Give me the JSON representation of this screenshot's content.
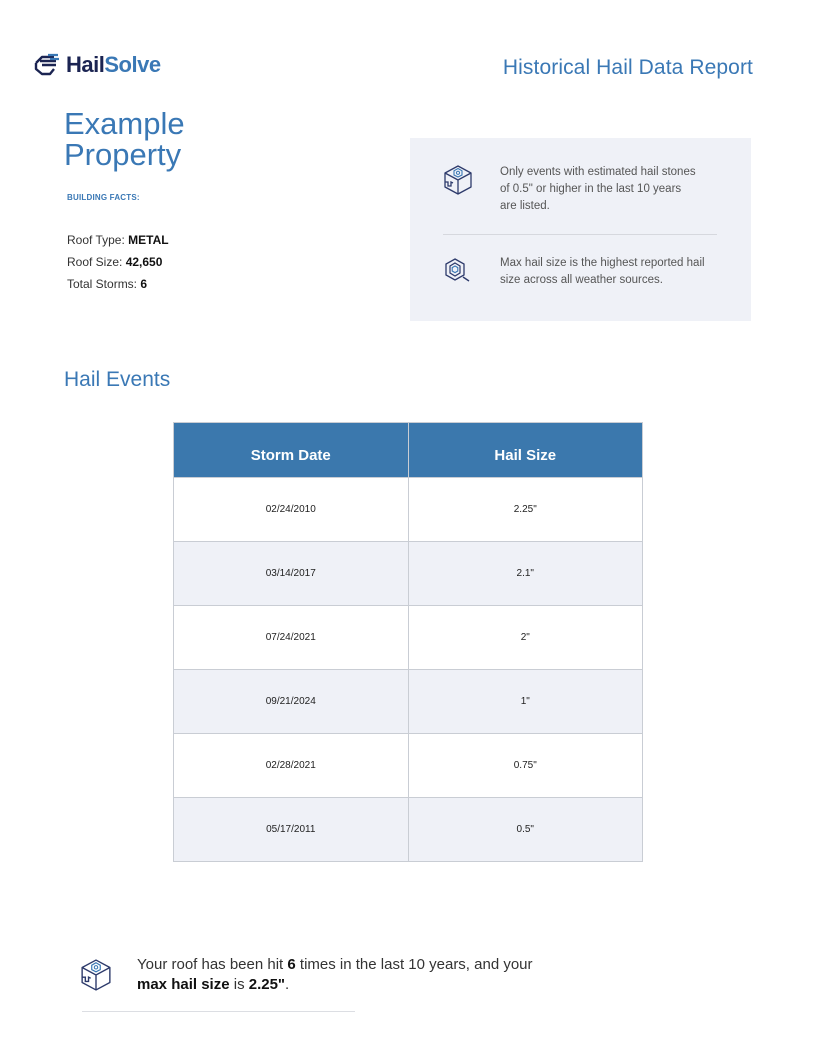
{
  "header": {
    "logo_text_part1": "Hail",
    "logo_text_part2": "Solve",
    "report_title": "Historical Hail Data Report"
  },
  "property": {
    "name": "Example Property",
    "facts_label": "BUILDING FACTS:",
    "facts": [
      {
        "label": "Roof Type: ",
        "value": "METAL"
      },
      {
        "label": "Roof Size: ",
        "value": "42,650"
      },
      {
        "label": "Total Storms: ",
        "value": "6"
      }
    ]
  },
  "info_box": {
    "items": [
      {
        "icon": "roof-cube-icon",
        "text": "Only events with estimated hail stones of 0.5\" or higher in the last 10 years are listed."
      },
      {
        "icon": "hail-search-icon",
        "text": "Max hail size is the highest reported hail size across all weather sources."
      }
    ]
  },
  "events": {
    "title": "Hail Events",
    "columns": [
      "Storm Date",
      "Hail Size"
    ],
    "rows": [
      [
        "02/24/2010",
        "2.25\""
      ],
      [
        "03/14/2017",
        "2.1\""
      ],
      [
        "07/24/2021",
        "2\""
      ],
      [
        "09/21/2024",
        "1\""
      ],
      [
        "02/28/2021",
        "0.75\""
      ],
      [
        "05/17/2011",
        "0.5\""
      ]
    ]
  },
  "summary": {
    "part1": "Your roof has been hit ",
    "hits": "6",
    "part2": " times in the last 10 years, and your ",
    "max_label": "max hail size",
    "part3": " is ",
    "max_value": "2.25\"",
    "part4": "."
  },
  "colors": {
    "brand_blue": "#3a78b5",
    "brand_navy": "#1b2452",
    "table_header": "#3b78ad",
    "panel_bg": "#eff1f7"
  }
}
